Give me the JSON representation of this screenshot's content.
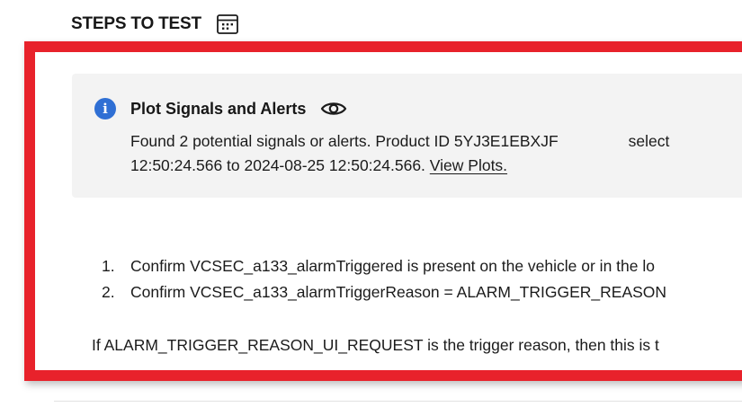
{
  "section": {
    "title": "STEPS TO TEST",
    "icon": "calendar-icon"
  },
  "alert": {
    "icon": "info-icon",
    "icon_glyph": "i",
    "title": "Plot Signals and Alerts",
    "title_icon": "eye-icon",
    "line1_part1": "Found 2 potential signals or alerts. Product ID 5YJ3E1EBXJF",
    "line1_part2": "select",
    "line2_text": "12:50:24.566 to 2024-08-25 12:50:24.566. ",
    "link_label": "View Plots."
  },
  "steps": [
    {
      "num": "1.",
      "text": "Confirm VCSEC_a133_alarmTriggered is present on the vehicle or in the lo"
    },
    {
      "num": "2.",
      "text": "Confirm VCSEC_a133_alarmTriggerReason = ALARM_TRIGGER_REASON"
    }
  ],
  "note": "If ALARM_TRIGGER_REASON_UI_REQUEST is the trigger reason, then this is t",
  "colors": {
    "highlight_border": "#e8222b",
    "alert_background": "#f3f3f3",
    "info_icon": "#2f6fd4"
  }
}
